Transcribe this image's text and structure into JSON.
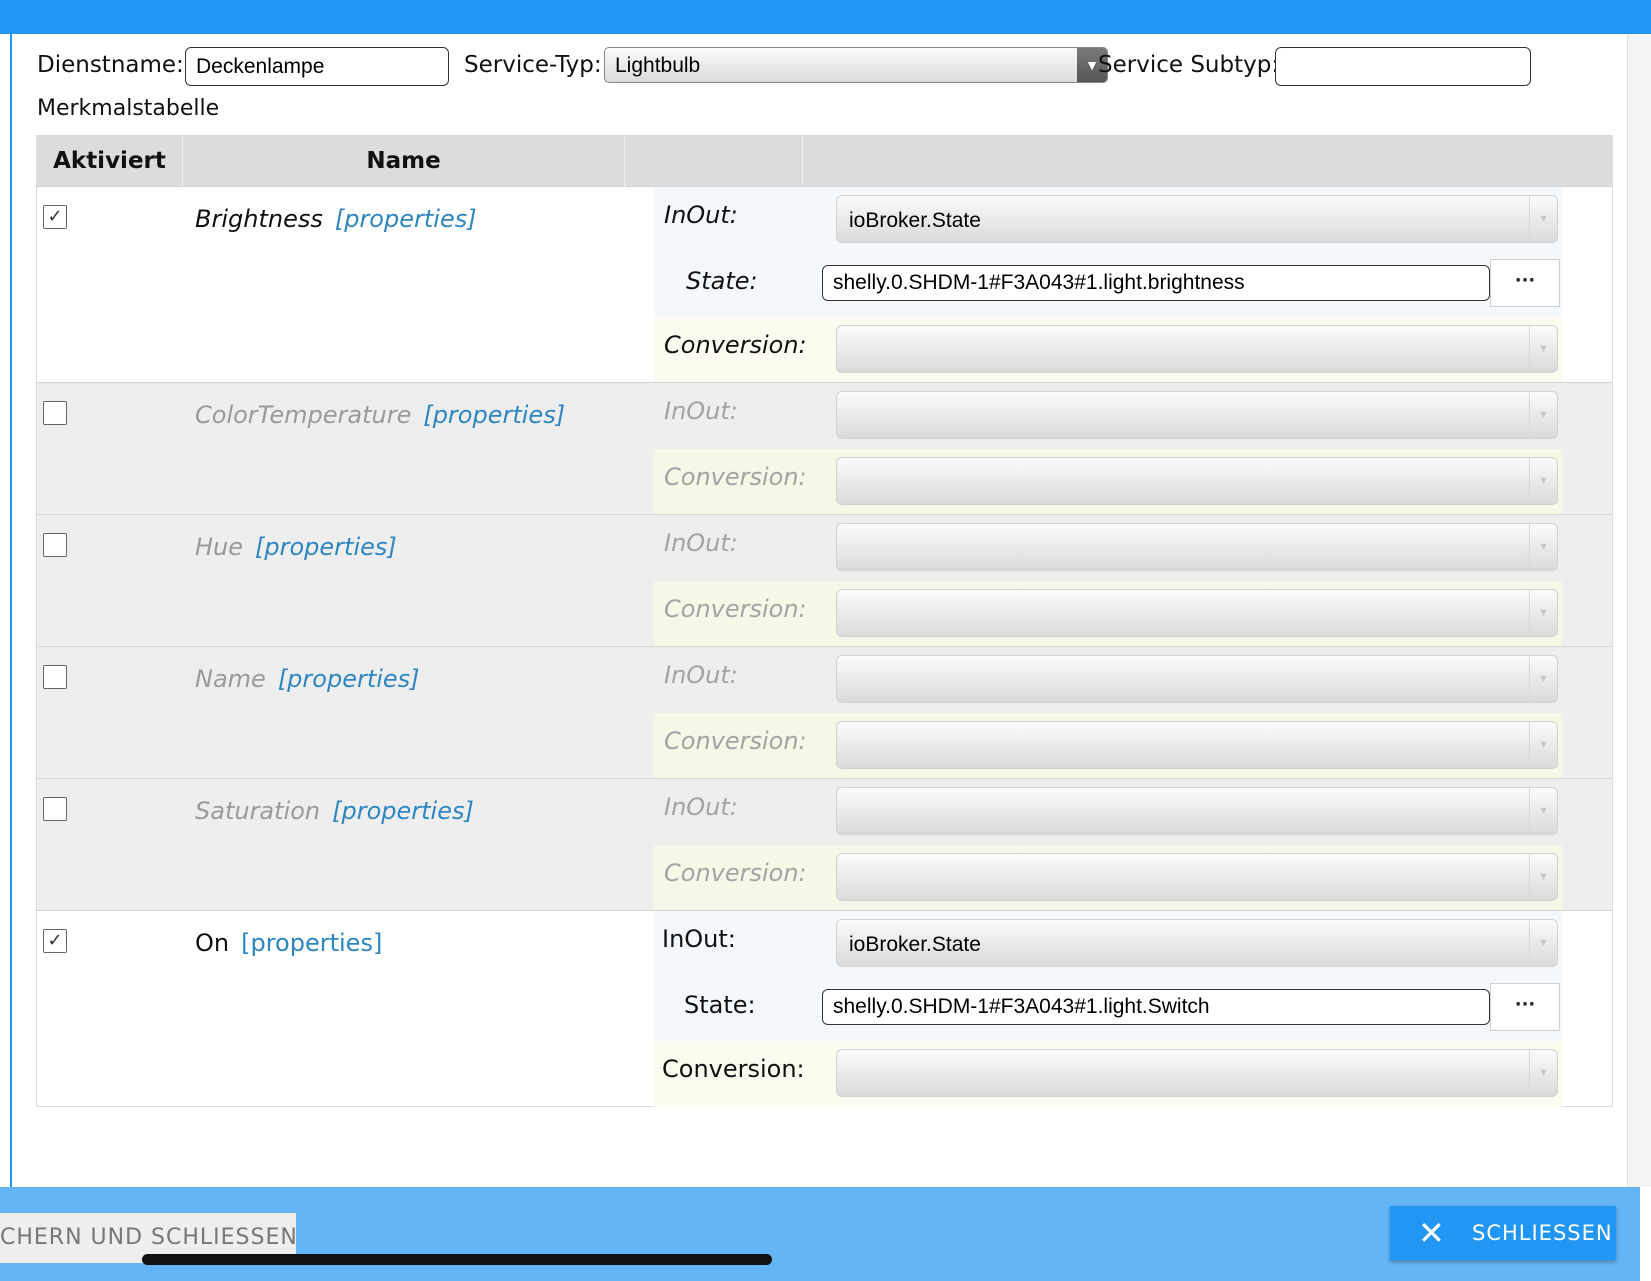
{
  "header": {
    "service_name_label": "Dienstname:",
    "service_name_value": "Deckenlampe",
    "service_type_label": "Service-Typ:",
    "service_type_value": "Lightbulb",
    "service_subtype_label": "Service Subtyp:",
    "service_subtype_value": ""
  },
  "table": {
    "caption": "Merkmalstabelle",
    "col_enabled": "Aktiviert",
    "col_name": "Name",
    "props_label": "[properties]",
    "inout_label": "InOut:",
    "state_label": "State:",
    "conversion_label": "Conversion:",
    "dots_label": "···",
    "rows": [
      {
        "name": "Brightness",
        "enabled": true,
        "inout": "ioBroker.State",
        "state": "shelly.0.SHDM-1#F3A043#1.light.brightness",
        "conversion": ""
      },
      {
        "name": "ColorTemperature",
        "enabled": false,
        "inout": "",
        "conversion": ""
      },
      {
        "name": "Hue",
        "enabled": false,
        "inout": "",
        "conversion": ""
      },
      {
        "name": "Name",
        "enabled": false,
        "inout": "",
        "conversion": ""
      },
      {
        "name": "Saturation",
        "enabled": false,
        "inout": "",
        "conversion": ""
      },
      {
        "name": "On",
        "enabled": true,
        "inout": "ioBroker.State",
        "state": "shelly.0.SHDM-1#F3A043#1.light.Switch",
        "conversion": ""
      }
    ]
  },
  "footer": {
    "save_label": "CHERN UND SCHLIESSEN",
    "close_label": "SCHLIESSEN",
    "close_icon": "✕"
  },
  "colors": {
    "accent": "#2196f3",
    "footer": "#64b5f6",
    "link": "#2e86c1"
  }
}
